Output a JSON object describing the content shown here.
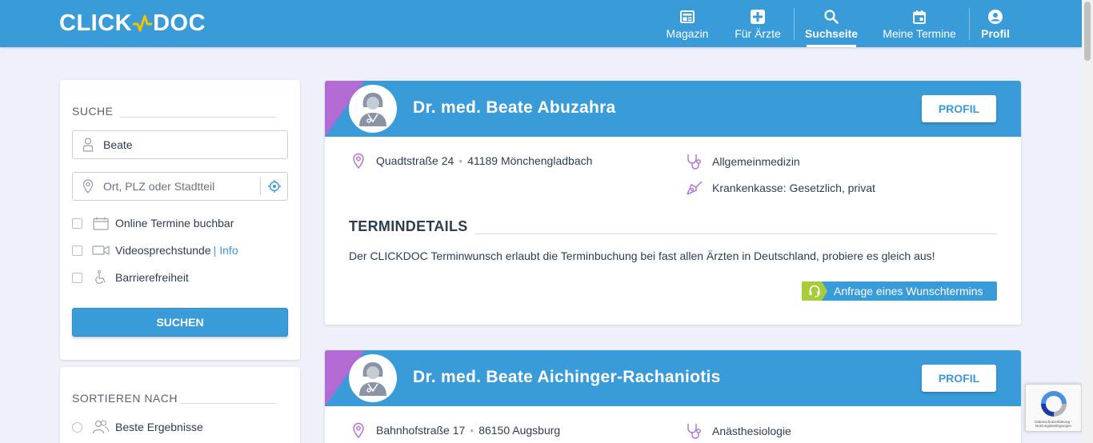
{
  "header": {
    "logo_left": "CLICK",
    "logo_right": "DOC",
    "nav": [
      {
        "label": "Magazin",
        "icon": "newspaper-icon"
      },
      {
        "label": "Für Ärzte",
        "icon": "medical-cross-icon"
      },
      {
        "label": "Suchseite",
        "icon": "search-icon",
        "active": true
      },
      {
        "label": "Meine Termine",
        "icon": "calendar-icon"
      },
      {
        "label": "Profil",
        "icon": "user-circle-icon"
      }
    ]
  },
  "search": {
    "title": "SUCHE",
    "name_value": "Beate",
    "location_placeholder": "Ort, PLZ oder Stadtteil",
    "options": [
      {
        "label": "Online Termine buchbar",
        "icon": "calendar-icon"
      },
      {
        "label": "Videosprechstunde",
        "icon": "video-camera-icon",
        "link": "Info"
      },
      {
        "label": "Barrierefreiheit",
        "icon": "wheelchair-icon"
      }
    ],
    "submit_label": "SUCHEN"
  },
  "sort": {
    "title": "SORTIEREN NACH",
    "options": [
      {
        "label": "Beste Ergebnisse",
        "icon": "users-icon"
      }
    ]
  },
  "results": [
    {
      "name": "Dr. med. Beate Abuzahra",
      "profile_label": "PROFIL",
      "street": "Quadtstraße 24",
      "city": "41189 Mönchengladbach",
      "specialty": "Allgemeinmedizin",
      "insurance": "Krankenkasse: Gesetzlich, privat",
      "termindetails_title": "TERMINDETAILS",
      "termindetails_text": "Der CLICKDOC Terminwunsch erlaubt die Terminbuchung bei fast allen Ärzten in Deutschland, probiere es gleich aus!",
      "wish_button": "Anfrage eines Wunschtermins"
    },
    {
      "name": "Dr. med. Beate Aichinger-Rachaniotis",
      "profile_label": "PROFIL",
      "street": "Bahnhofstraße 17",
      "city": "86150 Augsburg",
      "specialty": "Anästhesiologie"
    }
  ],
  "recaptcha": {
    "text": "Datenschutzerklärung - Nutzungsbedingungen"
  },
  "colors": {
    "primary": "#3a9bd9",
    "accent_purple": "#b16bd3",
    "accent_green": "#a6cc3a",
    "background": "#eef1f9"
  }
}
